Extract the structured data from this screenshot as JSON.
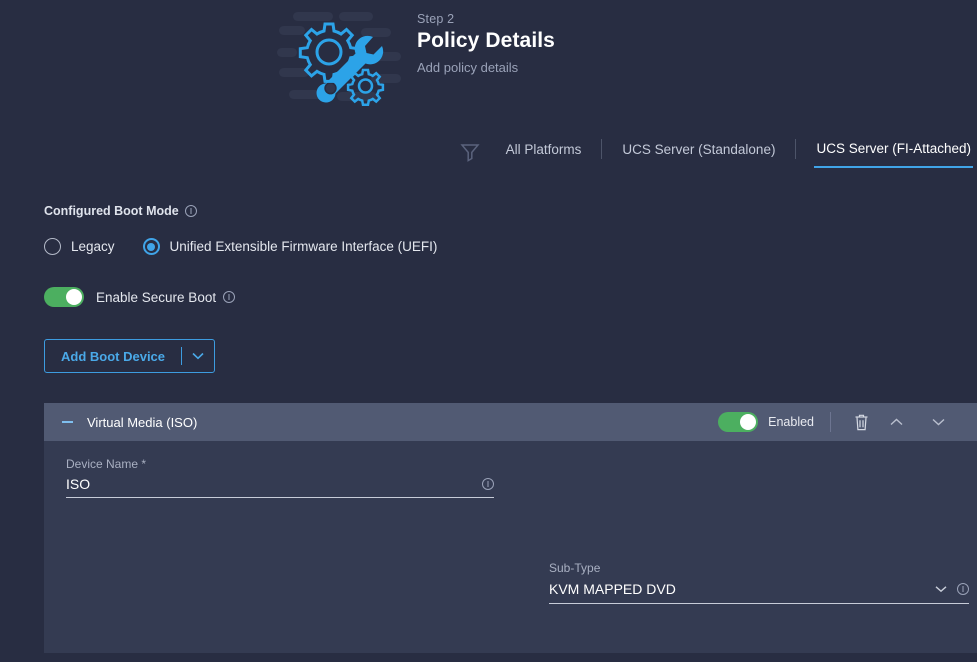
{
  "header": {
    "step": "Step 2",
    "title": "Policy Details",
    "subtitle": "Add policy details",
    "illustration_icon": "gears-wrench-illustration"
  },
  "tabs": {
    "filter_icon": "filter-funnel-icon",
    "items": [
      {
        "label": "All Platforms",
        "active": false
      },
      {
        "label": "UCS Server (Standalone)",
        "active": false
      },
      {
        "label": "UCS Server (FI-Attached)",
        "active": true
      }
    ]
  },
  "boot_mode": {
    "label": "Configured Boot Mode",
    "info_icon": "info-icon",
    "options": [
      {
        "label": "Legacy",
        "selected": false
      },
      {
        "label": "Unified Extensible Firmware Interface (UEFI)",
        "selected": true
      }
    ]
  },
  "secure_boot": {
    "label": "Enable Secure Boot",
    "enabled": true,
    "info_icon": "info-icon"
  },
  "add_boot_device": {
    "label": "Add Boot Device",
    "caret_icon": "chevron-down-icon"
  },
  "device": {
    "collapse_icon": "collapse-minus-icon",
    "title": "Virtual Media (ISO)",
    "enabled": true,
    "enabled_label": "Enabled",
    "delete_icon": "trash-icon",
    "move_up_icon": "chevron-up-icon",
    "move_down_icon": "chevron-down-icon",
    "fields": {
      "device_name": {
        "label": "Device Name *",
        "value": "ISO",
        "info_icon": "info-icon"
      },
      "sub_type": {
        "label": "Sub-Type",
        "value": "KVM MAPPED DVD",
        "caret_icon": "chevron-down-icon",
        "info_icon": "info-icon"
      }
    }
  },
  "colors": {
    "background": "#282d42",
    "panel_header": "#515a73",
    "panel_body": "#343b52",
    "accent_blue": "#40a4e8",
    "toggle_green": "#4caf60"
  }
}
